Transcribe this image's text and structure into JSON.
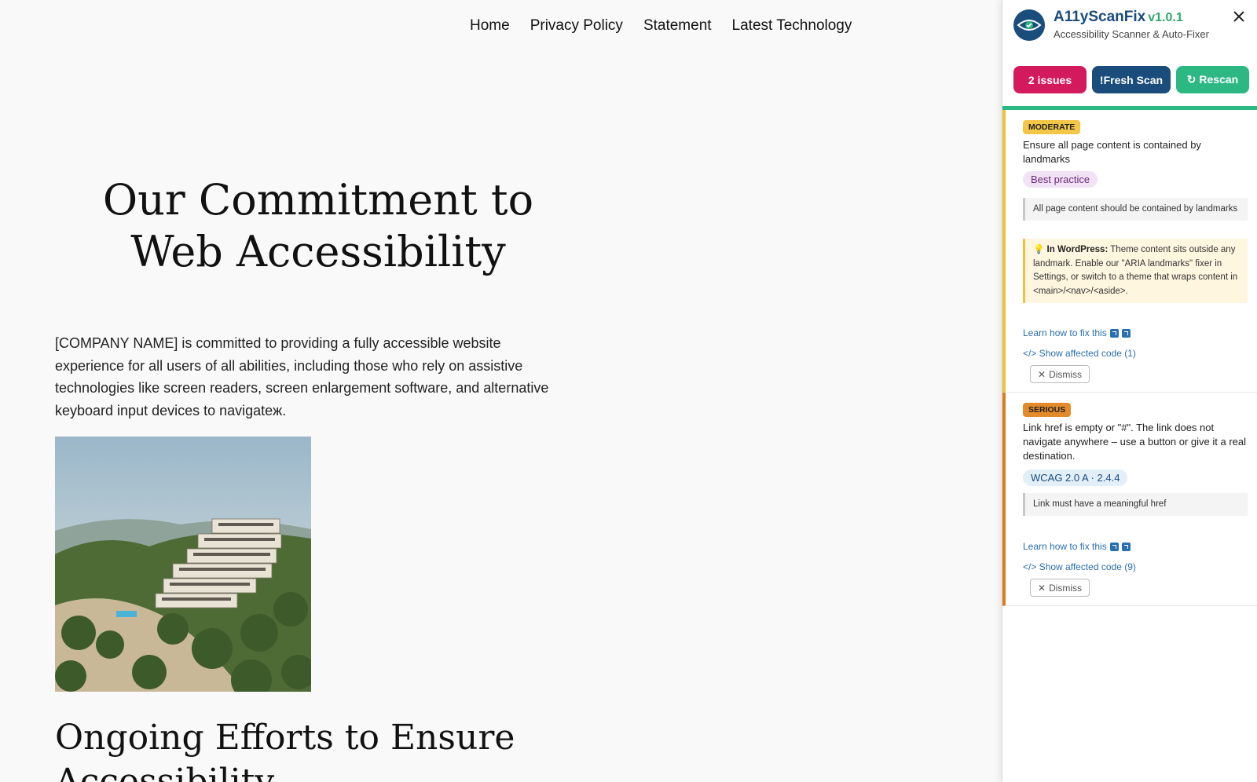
{
  "site": {
    "nav": [
      "Home",
      "Privacy Policy",
      "Statement",
      "Latest Technology"
    ],
    "hero_title": "Our Commitment to Web Accessibility",
    "intro": "[COMPANY NAME] is committed to providing a fully accessible website experience for all users of all abilities, including those who rely on assistive technologies like screen readers, screen enlargement software, and alternative keyboard input devices to navigateж.",
    "section_title": "Ongoing Efforts to Ensure Accessibility"
  },
  "panel": {
    "title": "A11yScanFix",
    "version": "v1.0.1",
    "subtitle": "Accessibility Scanner & Auto-Fixer",
    "buttons": {
      "issues": "2 issues",
      "fresh_scan": "!Fresh Scan",
      "rescan": "↻ Rescan"
    },
    "colors": {
      "brand": "#1a4c7c",
      "accent_green": "#2db883",
      "issues_red": "#d21a5d",
      "moderate": "#f0c03a",
      "serious": "#e07a1f"
    },
    "issues": [
      {
        "severity": "MODERATE",
        "description": "Ensure all page content is contained by landmarks",
        "tag": "Best practice",
        "help": "All page content should be contained by landmarks",
        "tip_label": "In WordPress:",
        "tip_text": "Theme content sits outside any landmark. Enable our \"ARIA landmarks\" fixer in Settings, or switch to a theme that wraps content in <main>/<nav>/<aside>.",
        "learn": "Learn how to fix this",
        "code": "</> Show affected code (1)",
        "dismiss": "Dismiss"
      },
      {
        "severity": "SERIOUS",
        "description": "Link href is empty or \"#\". The link does not navigate anywhere – use a button or give it a real destination.",
        "tag": "WCAG 2.0 A · 2.4.4",
        "help": "Link must have a meaningful href",
        "learn": "Learn how to fix this",
        "code": "</> Show affected code (9)",
        "dismiss": "Dismiss"
      }
    ]
  }
}
